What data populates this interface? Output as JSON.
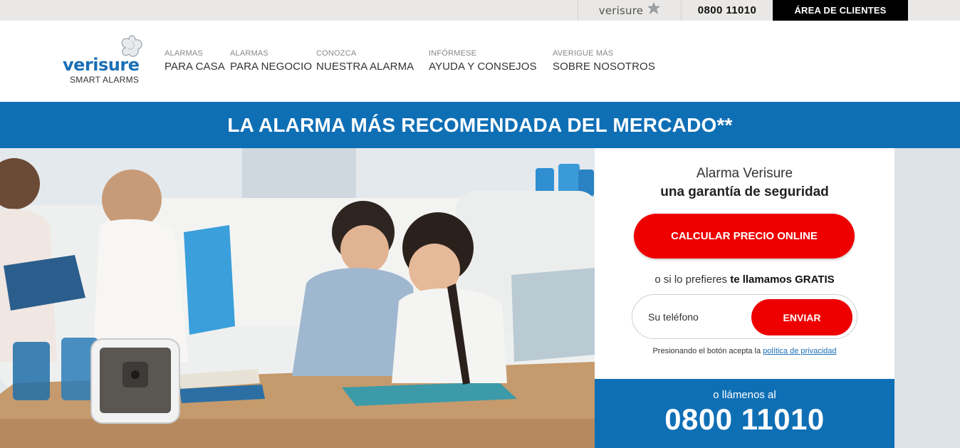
{
  "topbar": {
    "brand": "verisure",
    "phone": "0800 11010",
    "client_area": "ÁREA DE CLIENTES"
  },
  "logo": {
    "wordmark": "verisure",
    "tagline": "SMART ALARMS"
  },
  "nav": [
    {
      "small": "ALARMAS",
      "label": "PARA CASA"
    },
    {
      "small": "ALARMAS",
      "label": "PARA NEGOCIO"
    },
    {
      "small": "CONOZCA",
      "label": "NUESTRA ALARMA"
    },
    {
      "small": "INFÓRMESE",
      "label": "AYUDA Y CONSEJOS"
    },
    {
      "small": "AVERIGUE MÁS",
      "label": "SOBRE NOSOTROS"
    }
  ],
  "banner": {
    "headline": "LA ALARMA MÁS RECOMENDADA DEL MERCADO**"
  },
  "panel": {
    "title": "Alarma Verisure",
    "subtitle": "una garantía de seguridad",
    "cta": "CALCULAR PRECIO ONLINE",
    "prefer_prefix": "o si lo prefieres ",
    "prefer_bold": "te llamamos GRATIS",
    "phone_placeholder": "Su teléfono",
    "send": "ENVIAR",
    "legal_prefix": "Presionando el botón acepta la ",
    "legal_link": "política de privacidad"
  },
  "callbox": {
    "label": "o llámenos al",
    "number": "0800 11010"
  },
  "colors": {
    "brand_blue": "#0f6fb5",
    "cta_red": "#ee0000",
    "topbar_gray": "#e9e8e6"
  }
}
